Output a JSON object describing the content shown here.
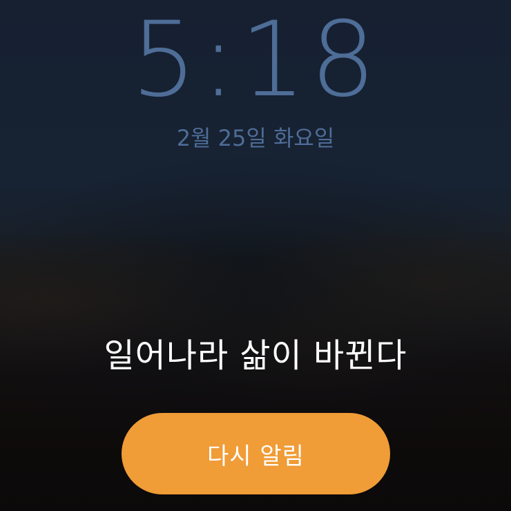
{
  "lockscreen": {
    "time": "5:18",
    "date": "2월 25일 화요일"
  },
  "alarm": {
    "label": "일어나라 삶이 바뀐다",
    "snooze_label": "다시 알림"
  },
  "colors": {
    "clock_text": "#4e6d97",
    "snooze_button": "#f09c37",
    "alarm_text": "#ffffff"
  }
}
